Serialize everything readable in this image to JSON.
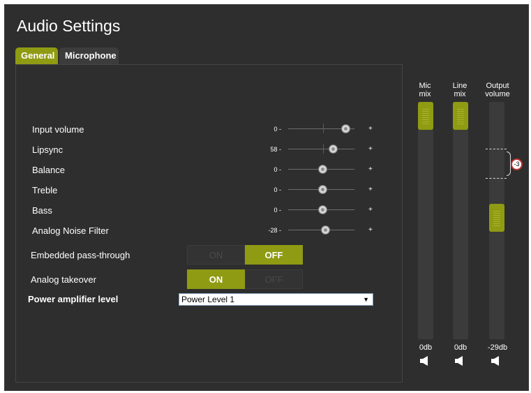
{
  "page": {
    "title": "Audio Settings"
  },
  "tabs": [
    {
      "label": "General",
      "active": true
    },
    {
      "label": "Microphone",
      "active": false
    }
  ],
  "sliders": [
    {
      "label": "Input volume",
      "value": "0",
      "position": 0.87
    },
    {
      "label": "Lipsync",
      "value": "58",
      "position": 0.68
    },
    {
      "label": "Balance",
      "value": "0",
      "position": 0.5
    },
    {
      "label": "Treble",
      "value": "0",
      "position": 0.5
    },
    {
      "label": "Bass",
      "value": "0",
      "position": 0.5
    },
    {
      "label": "Analog Noise Filter",
      "value": "-28",
      "position": 0.55
    }
  ],
  "slider_symbols": {
    "minus": "-",
    "plus": "+"
  },
  "toggles": {
    "embedded": {
      "label": "Embedded pass-through",
      "on": "ON",
      "off": "OFF",
      "state": "off"
    },
    "takeover": {
      "label": "Analog takeover",
      "on": "ON",
      "off": "OFF",
      "state": "on"
    }
  },
  "amplifier": {
    "label": "Power amplifier level",
    "selected": "Power Level 1"
  },
  "mixers": [
    {
      "label_line1": "Mic",
      "label_line2": "mix",
      "db": "0db",
      "level": 1.0
    },
    {
      "label_line1": "Line",
      "label_line2": "mix",
      "db": "0db",
      "level": 1.0
    },
    {
      "label_line1": "Output",
      "label_line2": "volume",
      "db": "-29db",
      "level": 0.57
    }
  ],
  "peak": {
    "value": "-3"
  },
  "colors": {
    "accent": "#8f9b12",
    "background": "#2e2e2e"
  },
  "icons": {
    "speaker": "speaker-icon",
    "dropdown": "chevron-down-icon"
  }
}
